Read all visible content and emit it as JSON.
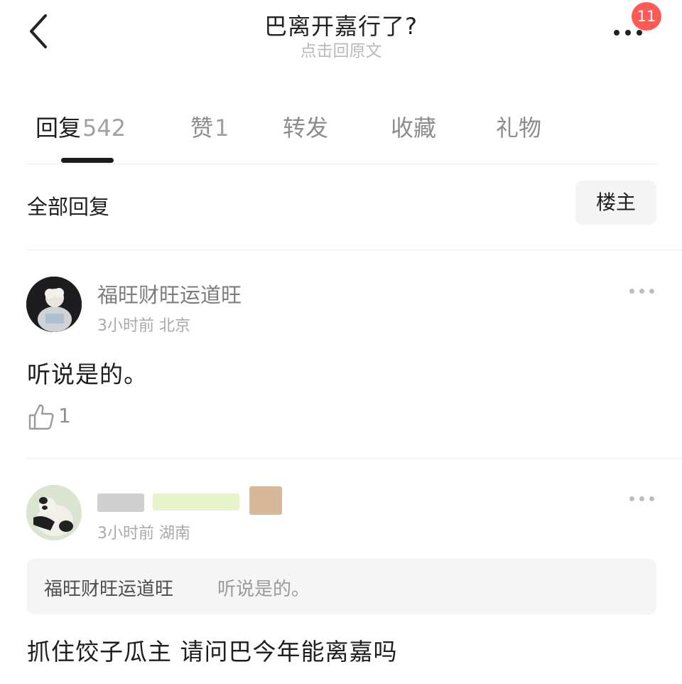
{
  "header": {
    "title": "巴离开嘉行了?",
    "subtitle": "点击回原文",
    "notification_count": "11",
    "icons": {
      "back": "chevron-left-icon",
      "more": "more-horizontal-icon"
    }
  },
  "tabs": [
    {
      "label": "回复",
      "count": "542",
      "active": true
    },
    {
      "label": "赞",
      "count": "1",
      "active": false
    },
    {
      "label": "转发",
      "count": "",
      "active": false
    },
    {
      "label": "收藏",
      "count": "",
      "active": false
    },
    {
      "label": "礼物",
      "count": "",
      "active": false
    }
  ],
  "filter": {
    "label": "全部回复",
    "owner_button": "楼主"
  },
  "comments": [
    {
      "username": "福旺财旺运道旺",
      "time": "3小时前",
      "location": "北京",
      "text": "听说是的。",
      "likes": "1"
    },
    {
      "username": "",
      "time": "3小时前",
      "location": "湖南",
      "quote_author": "福旺财旺运道旺",
      "quote_text": "听说是的。",
      "text": "抓住饺子瓜主 请问巴今年能离嘉吗"
    }
  ],
  "colors": {
    "badge": "#ff5a55",
    "tab_indicator": "#1b1b1b",
    "muted_text": "#a9a9a9"
  }
}
